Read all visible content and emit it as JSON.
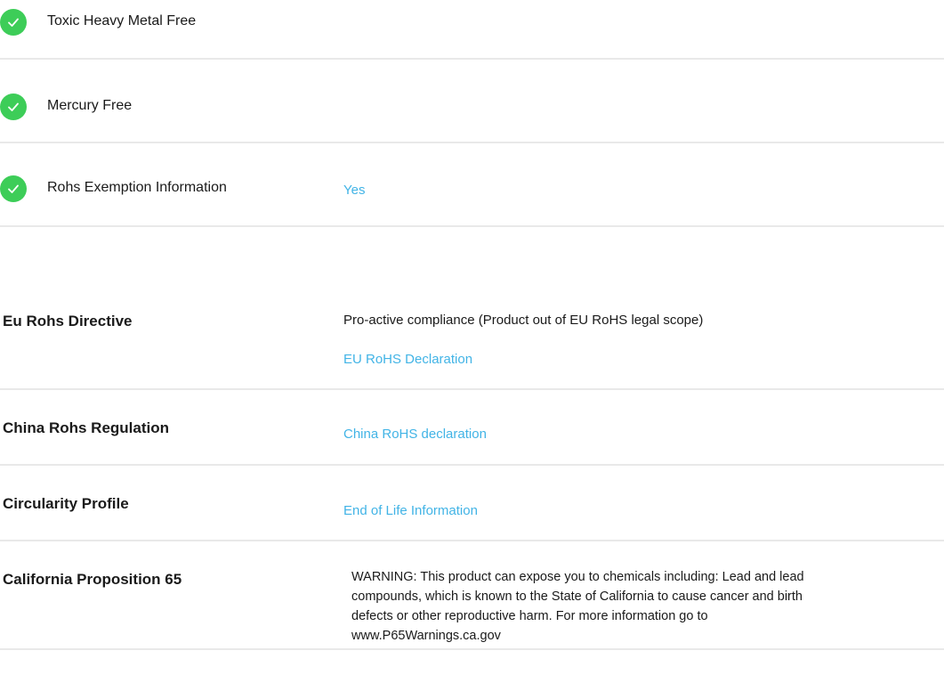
{
  "environment": {
    "checks": [
      {
        "label": "Toxic Heavy Metal Free",
        "value": "",
        "icon": "check-circle-icon"
      },
      {
        "label": "Mercury Free",
        "value": "",
        "icon": "check-circle-icon"
      },
      {
        "label": "Rohs Exemption Information",
        "value": "Yes",
        "icon": "check-circle-icon"
      }
    ]
  },
  "specs": {
    "eu_rohs": {
      "label": "Eu Rohs Directive",
      "text": "Pro-active compliance (Product out of EU RoHS legal scope)",
      "link": "EU RoHS Declaration"
    },
    "china_rohs": {
      "label": "China Rohs Regulation",
      "link": "China RoHS declaration"
    },
    "circularity": {
      "label": "Circularity Profile",
      "link": "End of Life Information"
    },
    "prop65": {
      "label": "California Proposition 65",
      "lines": [
        "WARNING: This product can expose you to chemicals including: Lead and lead",
        "compounds, which is known to the State of California to cause cancer and birth",
        "defects or other reproductive harm. For more information go to",
        "www.P65Warnings.ca.gov"
      ]
    }
  },
  "colors": {
    "check": "#3dcd58",
    "link": "#42b4e6",
    "divider": "#e9e9e9",
    "text": "#1a1a1a"
  }
}
